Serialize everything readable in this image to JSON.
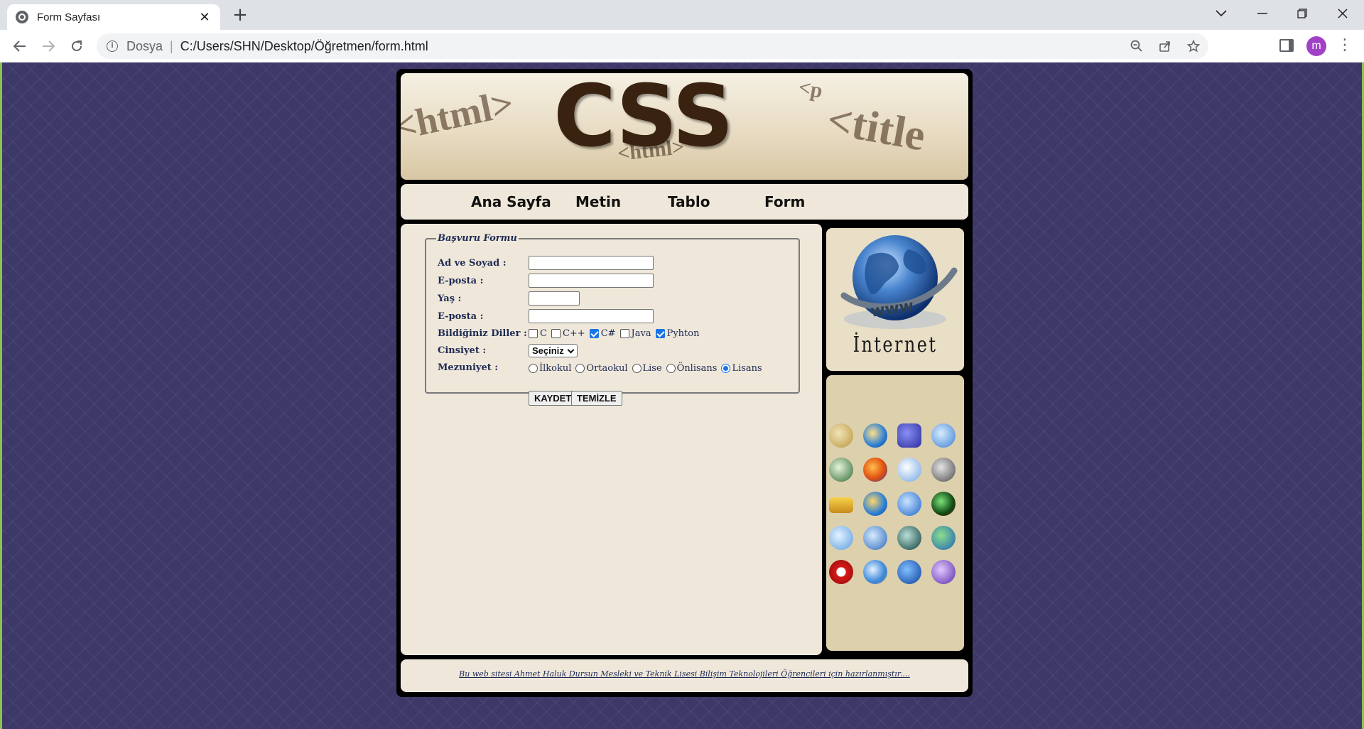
{
  "browser": {
    "tab_title": "Form Sayfası",
    "address_label": "Dosya",
    "url": "C:/Users/SHN/Desktop/Öğretmen/form.html",
    "profile_initial": "m"
  },
  "header": {
    "title_text": "CSS",
    "bg_words": [
      "<html>",
      "<title",
      "<html>",
      "<p"
    ]
  },
  "nav": {
    "items": [
      "Ana Sayfa",
      "Metin",
      "Tablo",
      "Form"
    ]
  },
  "form": {
    "legend": "Başvuru Formu",
    "labels": {
      "name": "Ad ve Soyad :",
      "email1": "E-posta :",
      "age": "Yaş :",
      "email2": "E-posta :",
      "languages": "Bildiğiniz Diller :",
      "gender": "Cinsiyet :",
      "graduation": "Mezuniyet :"
    },
    "languages": [
      {
        "label": "C",
        "checked": false
      },
      {
        "label": "C++",
        "checked": false
      },
      {
        "label": "C#",
        "checked": true
      },
      {
        "label": "Java",
        "checked": false
      },
      {
        "label": "Pyhton",
        "checked": true
      }
    ],
    "gender_select": "Seçiniz",
    "graduation_options": [
      {
        "label": "İlkokul",
        "checked": false
      },
      {
        "label": "Ortaokul",
        "checked": false
      },
      {
        "label": "Lise",
        "checked": false
      },
      {
        "label": "Önlisans",
        "checked": false
      },
      {
        "label": "Lisans",
        "checked": true
      }
    ],
    "save_button": "KAYDET",
    "clear_button": "TEMİZLE"
  },
  "sidebar": {
    "internet_label": "İnternet",
    "browser_icons": [
      "aol-icon",
      "ie-old-icon",
      "avant-icon",
      "kmeleon-icon",
      "epiphany-icon",
      "firefox-icon",
      "browser-blue-icon",
      "galeon-icon",
      "taxi-icon",
      "ie-icon",
      "ie-blue-icon",
      "green-browser-icon",
      "konqueror-icon",
      "maxthon-icon",
      "netscape-icon",
      "globe-icon",
      "opera-icon",
      "safari-icon",
      "seamonkey-icon",
      "purple-browser-icon"
    ]
  },
  "footer": {
    "text": "Bu web sitesi Ahmet Haluk Dursun Mesleki ve Teknik Lisesi Bilişim Teknolojileri Öğrencileri için hazırlanmıştır...."
  },
  "colors": {
    "page_bg": "#3e3868",
    "panel_bg": "#efe8da",
    "frame": "#000000",
    "form_text": "#1e2a55"
  }
}
